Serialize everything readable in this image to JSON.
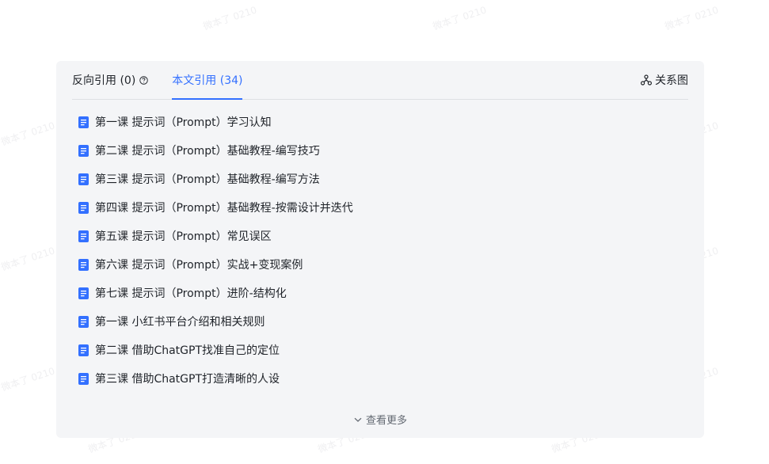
{
  "tabs": {
    "backlinks_label": "反向引用 (0)",
    "outlinks_label": "本文引用 (34)"
  },
  "graph_button_label": "关系图",
  "references": [
    "第一课 提示词（Prompt）学习认知",
    "第二课 提示词（Prompt）基础教程-编写技巧",
    "第三课 提示词（Prompt）基础教程-编写方法",
    "第四课 提示词（Prompt）基础教程-按需设计并迭代",
    "第五课 提示词（Prompt）常见误区",
    "第六课 提示词（Prompt）实战+变现案例",
    "第七课 提示词（Prompt）进阶-结构化",
    "第一课 小红书平台介绍和相关规则",
    "第二课 借助ChatGPT找准自己的定位",
    "第三课 借助ChatGPT打造清晰的人设"
  ],
  "show_more_label": "查看更多",
  "watermark_text": "微本了 0210",
  "colors": {
    "accent": "#3370ff",
    "doc_icon": "#3370ff",
    "panel_bg": "#f4f5f7"
  },
  "icons": {
    "help": "help-circle-icon",
    "graph": "relationship-graph-icon",
    "doc": "document-icon",
    "expand": "chevron-down-icon"
  }
}
